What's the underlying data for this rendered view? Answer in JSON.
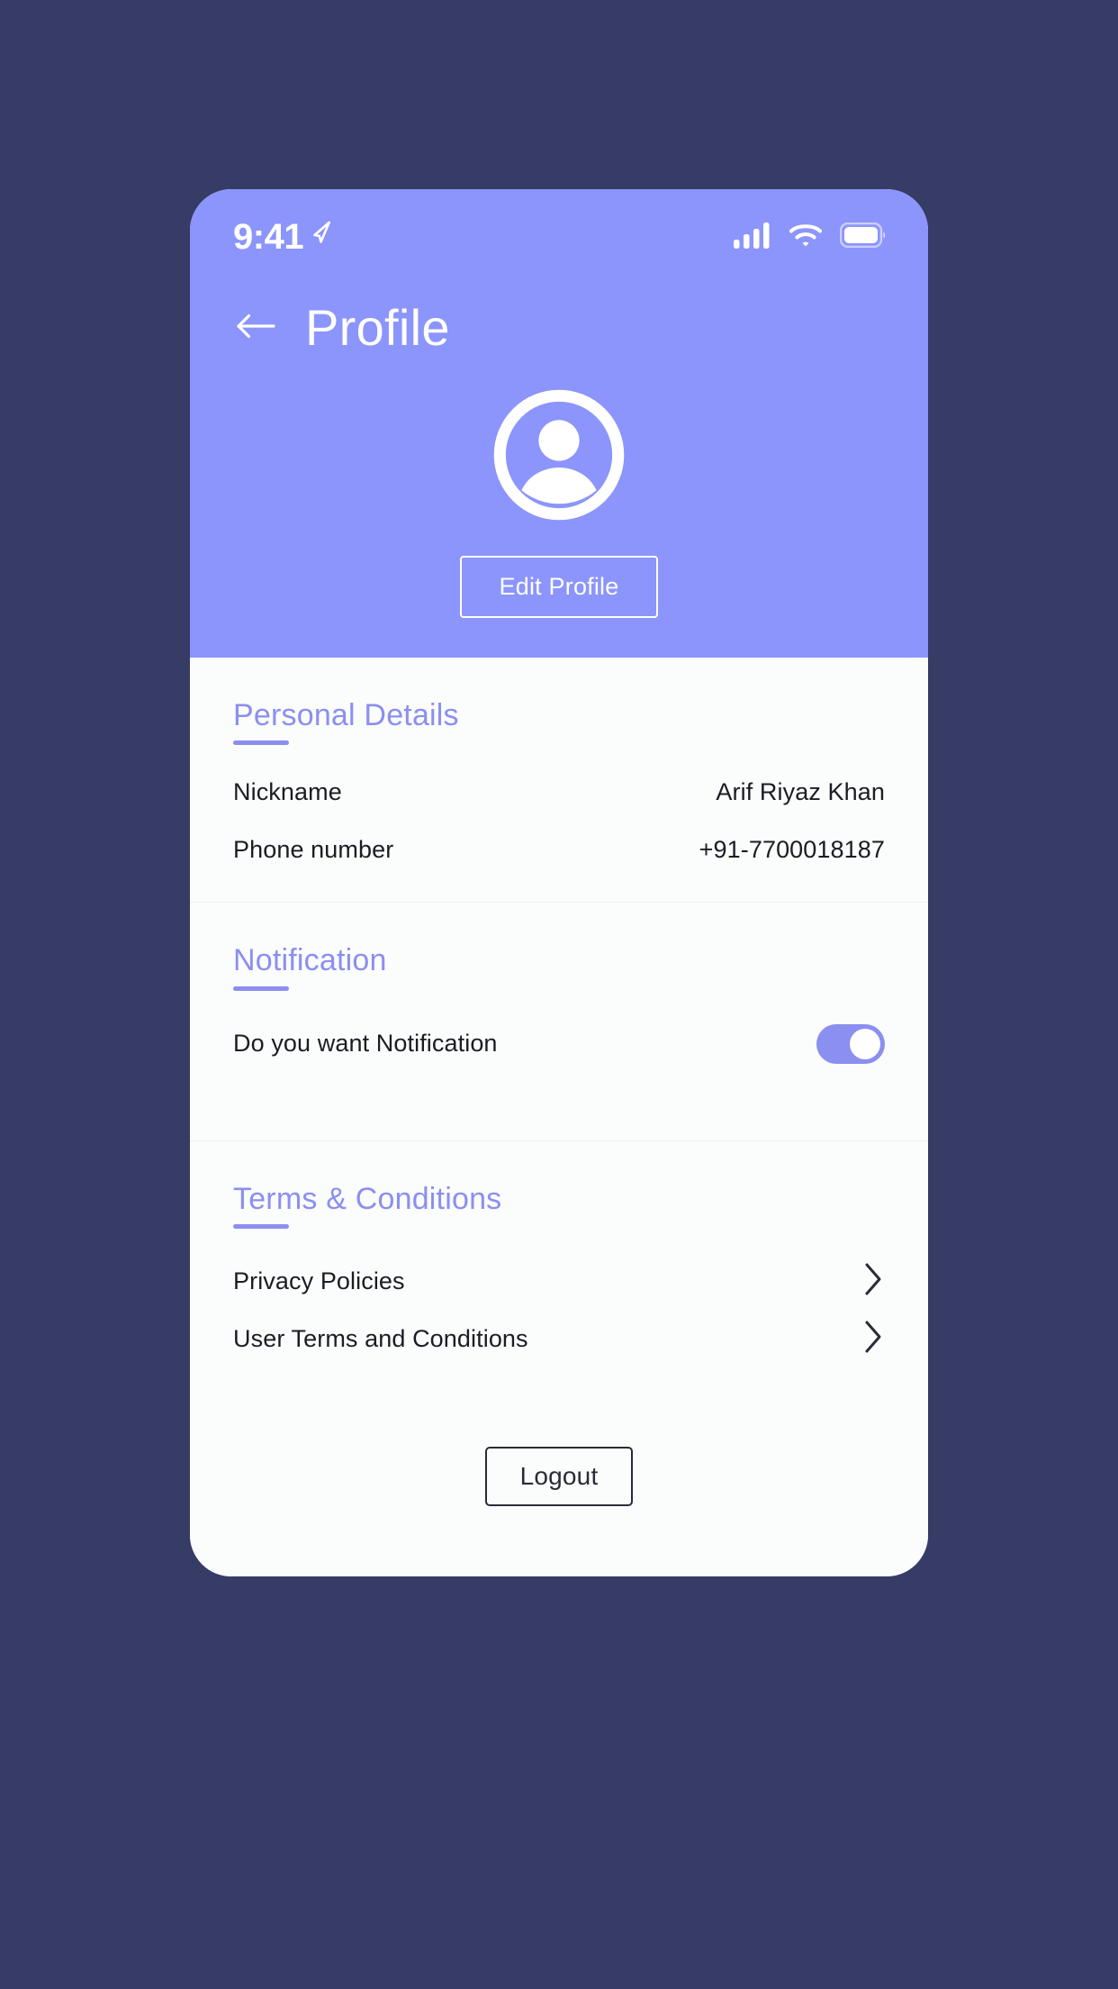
{
  "theme": {
    "page_background": "#363c66",
    "header_purple": "#8b95fb",
    "accent_purple": "#8b8ff0",
    "card_background": "#fbfcfc",
    "text_dark": "#1c1c24"
  },
  "status_bar": {
    "time": "9:41",
    "location_icon": "location-arrow-icon",
    "cellular_icon": "cellular-signal-icon",
    "wifi_icon": "wifi-icon",
    "battery_icon": "battery-full-icon"
  },
  "header": {
    "back_icon": "arrow-left-icon",
    "title": "Profile",
    "avatar_icon": "user-avatar-icon",
    "edit_profile_label": "Edit Profile"
  },
  "sections": [
    {
      "key": "personal_details",
      "title": "Personal Details",
      "rows": [
        {
          "label": "Nickname",
          "value": "Arif Riyaz Khan"
        },
        {
          "label": "Phone number",
          "value": "+91-7700018187"
        }
      ]
    },
    {
      "key": "notification",
      "title": "Notification",
      "rows": [
        {
          "label": "Do you want Notification",
          "toggle_on": true
        }
      ]
    },
    {
      "key": "terms_conditions",
      "title": "Terms & Conditions",
      "rows": [
        {
          "label": "Privacy Policies",
          "chevron": "chevron-right-icon"
        },
        {
          "label": "User Terms and Conditions",
          "chevron": "chevron-right-icon"
        }
      ]
    }
  ],
  "footer": {
    "logout_label": "Logout"
  }
}
